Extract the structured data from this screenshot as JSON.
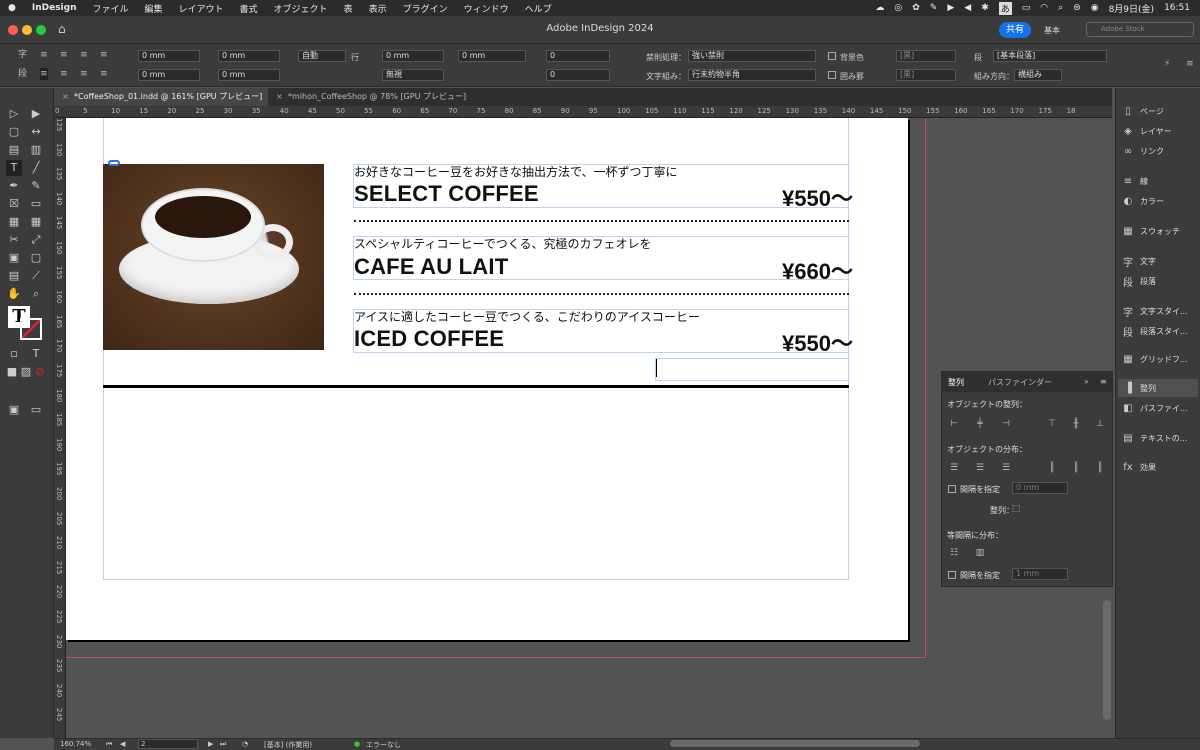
{
  "menubar": {
    "app": "InDesign",
    "items": [
      "ファイル",
      "編集",
      "レイアウト",
      "書式",
      "オブジェクト",
      "表",
      "表示",
      "プラグイン",
      "ウィンドウ",
      "ヘルプ"
    ],
    "ime": "あ",
    "date": "8月9日(金)",
    "time": "16:51"
  },
  "window": {
    "title": "Adobe InDesign 2024",
    "share": "共有",
    "workspace": "基本",
    "stock_placeholder": "Adobe Stock"
  },
  "control": {
    "v0mm": "0 mm",
    "auto": "自動",
    "row": "行",
    "none": "無視",
    "zero": "0",
    "kinsoku_label": "禁則処理：",
    "kinsoku": "強い禁則",
    "mojikumi_label": "文字組み：",
    "mojikumi": "行末約物半角",
    "bgcolor": "背景色",
    "kakomi": "囲み罫",
    "black": "[黒]",
    "style": "[基本段落]",
    "dan": "段",
    "direction_label": "組み方向：",
    "direction": "横組み",
    "ji": "字"
  },
  "tabs": [
    {
      "label": "*CoffeeShop_01.indd @ 161% [GPU プレビュー]"
    },
    {
      "label": "*mihon_CoffeeShop @ 78% [GPU プレビュー]"
    }
  ],
  "hruler": [
    "0",
    "5",
    "10",
    "15",
    "20",
    "25",
    "30",
    "35",
    "40",
    "45",
    "50",
    "55",
    "60",
    "65",
    "70",
    "75",
    "80",
    "85",
    "90",
    "95",
    "100",
    "105",
    "110",
    "115",
    "120",
    "125",
    "130",
    "135",
    "140",
    "145",
    "150",
    "155",
    "160",
    "165",
    "170",
    "175",
    "18"
  ],
  "vruler": [
    "125",
    "130",
    "135",
    "140",
    "145",
    "150",
    "155",
    "160",
    "165",
    "170",
    "175",
    "180",
    "185",
    "190",
    "195",
    "200",
    "205",
    "210",
    "215",
    "220",
    "225",
    "230",
    "235",
    "240",
    "245"
  ],
  "doc": {
    "items": [
      {
        "desc": "お好きなコーヒー豆をお好きな抽出方法で、一杯ずつ丁寧に",
        "name": "SELECT COFFEE",
        "price": "¥550〜"
      },
      {
        "desc": "スペシャルティコーヒーでつくる、究極のカフェオレを",
        "name": "CAFE AU LAIT",
        "price": "¥660〜"
      },
      {
        "desc": "アイスに適したコーヒー豆でつくる、こだわりのアイスコーヒー",
        "name": "ICED COFFEE",
        "price": "¥550〜"
      }
    ]
  },
  "dock": [
    {
      "label": "ページ",
      "icon": "pages-icon"
    },
    {
      "label": "レイヤー",
      "icon": "layers-icon"
    },
    {
      "label": "リンク",
      "icon": "links-icon"
    },
    {
      "label": "線",
      "icon": "stroke-icon"
    },
    {
      "label": "カラー",
      "icon": "color-icon"
    },
    {
      "label": "スウォッチ",
      "icon": "swatches-icon"
    },
    {
      "label": "文字",
      "icon": "character-icon"
    },
    {
      "label": "段落",
      "icon": "paragraph-icon"
    },
    {
      "label": "文字スタイ...",
      "icon": "char-style-icon"
    },
    {
      "label": "段落スタイ...",
      "icon": "para-style-icon"
    },
    {
      "label": "グリッドフ...",
      "icon": "grid-format-icon"
    },
    {
      "label": "整列",
      "icon": "align-icon"
    },
    {
      "label": "パスファイ...",
      "icon": "pathfinder-icon"
    },
    {
      "label": "テキストの...",
      "icon": "text-wrap-icon"
    },
    {
      "label": "効果",
      "icon": "effects-icon"
    }
  ],
  "align": {
    "tab1": "整列",
    "tab2": "パスファインダー",
    "obj_align": "オブジェクトの整列：",
    "obj_dist": "オブジェクトの分布：",
    "spacing1": "間隔を指定",
    "spacing1_val": "0 mm",
    "align_to": "整列：",
    "equal": "等間隔に分布：",
    "spacing2": "間隔を指定",
    "spacing2_val": "1 mm"
  },
  "status": {
    "zoom": "160.74%",
    "page": "2",
    "style": "[基本] (作業用)",
    "errors": "エラーなし"
  }
}
